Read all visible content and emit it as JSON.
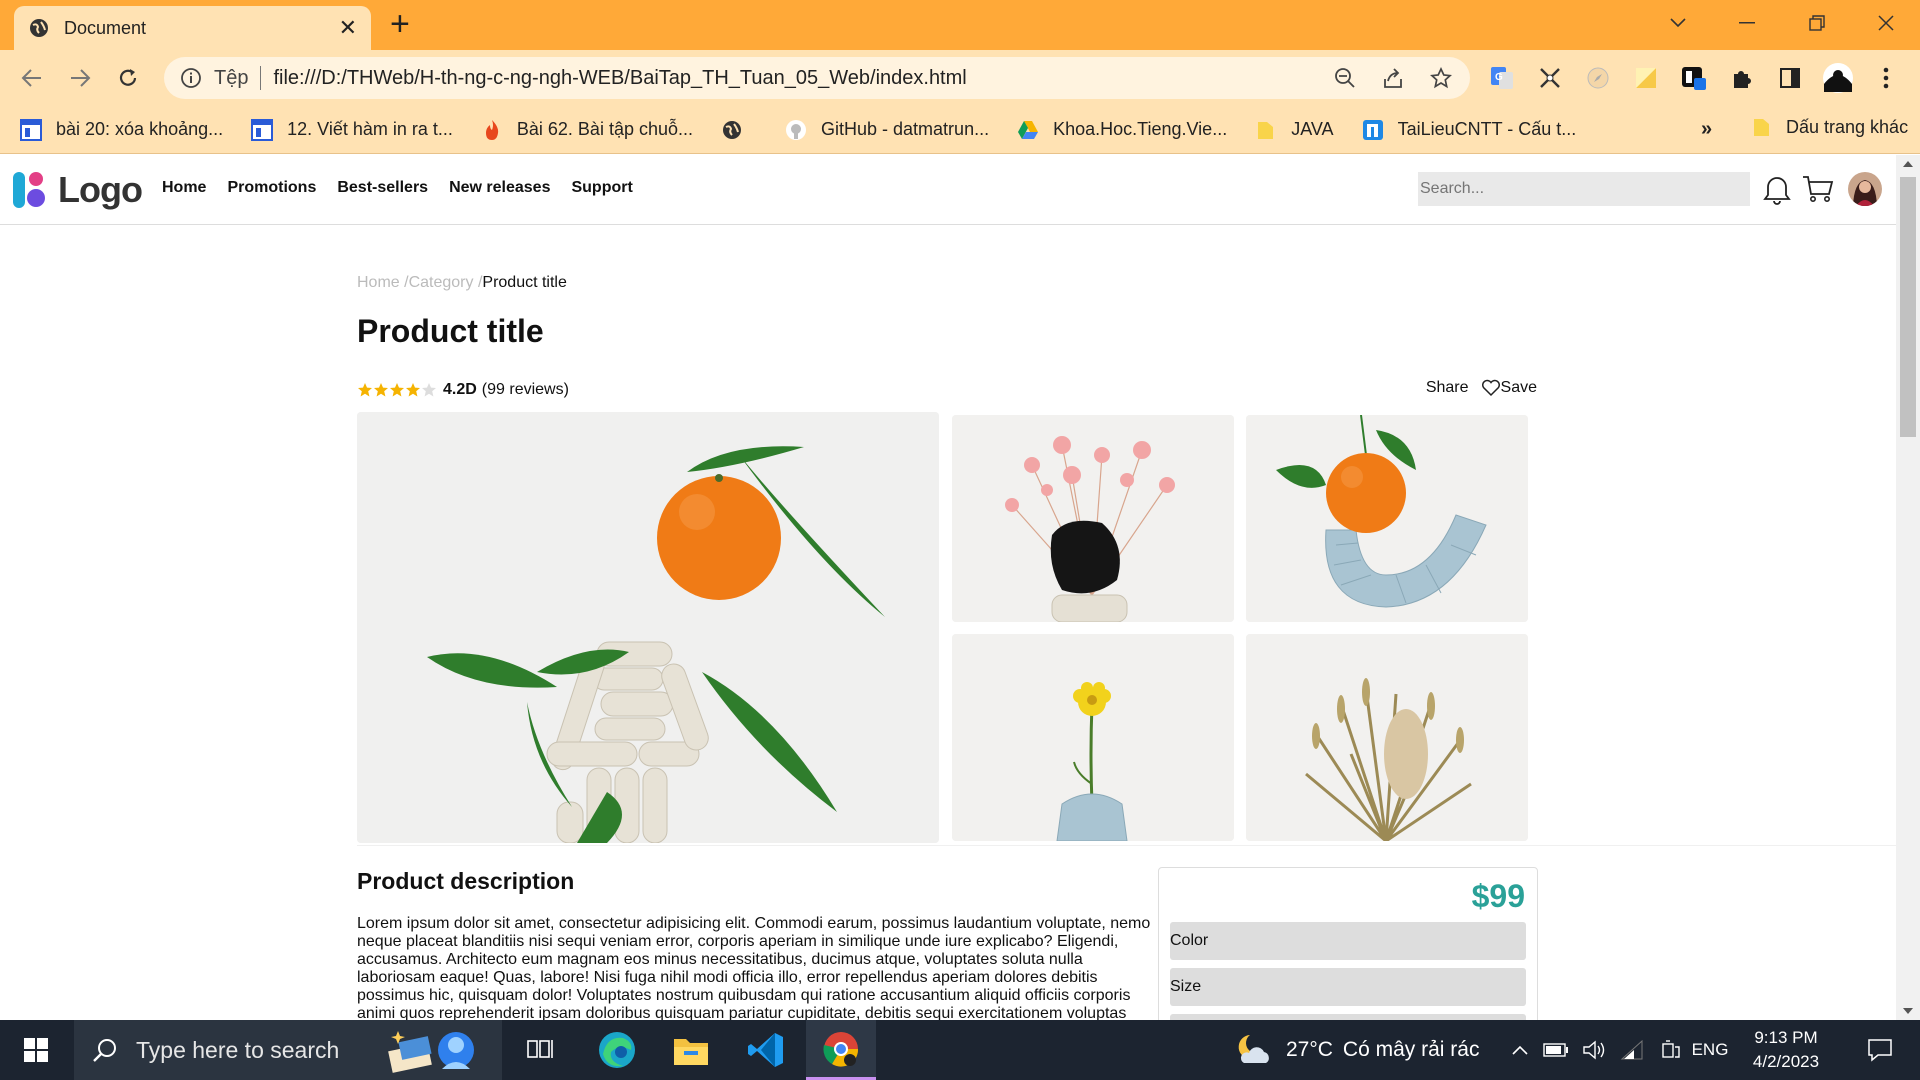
{
  "browser": {
    "tab_title": "Document",
    "omnibox": {
      "scheme_label": "Tệp",
      "url": "file:///D:/THWeb/H-th-ng-c-ng-ngh-WEB/BaiTap_TH_Tuan_05_Web/index.html"
    },
    "bookmarks": [
      {
        "label": "bài 20: xóa khoảng...",
        "icon": "bookmark-page-icon"
      },
      {
        "label": "12. Viết hàm in ra t...",
        "icon": "bookmark-page-icon"
      },
      {
        "label": "Bài 62. Bài tập chuỗ...",
        "icon": "flame-icon"
      },
      {
        "label": "",
        "icon": "globe-icon"
      },
      {
        "label": "GitHub - datmatrun...",
        "icon": "github-icon"
      },
      {
        "label": "Khoa.Hoc.Tieng.Vie...",
        "icon": "google-drive-icon"
      },
      {
        "label": "JAVA",
        "icon": "folder-icon"
      },
      {
        "label": "TaiLieuCNTT - Cấu t...",
        "icon": "tailieu-icon"
      }
    ],
    "bookmarks_overflow": "»",
    "other_bookmarks": "Dấu trang khác"
  },
  "site": {
    "logo_text": "Logo",
    "nav": [
      "Home",
      "Promotions",
      "Best-sellers",
      "New releases",
      "Support"
    ],
    "search_placeholder": "Search..."
  },
  "product": {
    "breadcrumb": {
      "home": "Home /",
      "category": "Category /",
      "current": "Product title"
    },
    "title": "Product title",
    "rating": {
      "stars": 4.5,
      "score": "4.2D",
      "reviews": "(99 reviews)"
    },
    "share_label": "Share",
    "save_label": "Save",
    "description_title": "Product description",
    "description_text": "Lorem ipsum dolor sit amet, consectetur adipisicing elit. Commodi earum, possimus laudantium voluptate, nemo neque placeat blanditiis nisi sequi veniam error, corporis aperiam in similique unde iure explicabo? Eligendi, accusamus. Architecto eum magnam eos minus necessitatibus, ducimus atque, voluptates soluta nulla laboriosam eaque! Quas, labore! Nisi fuga nihil modi officia illo, error repellendus aperiam dolores debitis possimus hic, quisquam dolor! Voluptates nostrum quibusdam qui ratione accusantium aliquid officiis corporis animi quos reprehenderit ipsam doloribus quisquam pariatur cupiditate, debitis sequi exercitationem voluptas",
    "price": "$99",
    "options": [
      "Color",
      "Size"
    ],
    "accent_color": "#2aa198"
  },
  "taskbar": {
    "search_placeholder": "Type here to search",
    "weather": {
      "temp": "27°C",
      "desc": "Có mây rải rác"
    },
    "language": "ENG",
    "time": "9:13 PM",
    "date": "4/2/2023"
  }
}
